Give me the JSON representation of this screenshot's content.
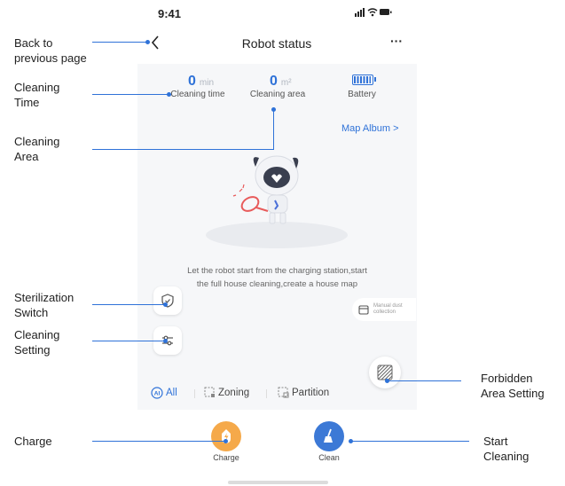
{
  "status_bar": {
    "time": "9:41",
    "icons": "signal wifi battery"
  },
  "nav": {
    "title": "Robot status",
    "more": "···"
  },
  "stats": {
    "time_value": "0",
    "time_unit": "min",
    "time_label": "Cleaning time",
    "area_value": "0",
    "area_unit": "m²",
    "area_label": "Cleaning area",
    "battery_label": "Battery",
    "battery_level": 1.0
  },
  "map_album": "Map Album >",
  "hint_line1": "Let the robot start from the charging station,start",
  "hint_line2": "the full house cleaning,create a house map",
  "dust_label": "Manual dust collection",
  "modes": {
    "all": "All",
    "zoning": "Zoning",
    "partition": "Partition",
    "all_badge": "AI"
  },
  "actions": {
    "charge": "Charge",
    "clean": "Clean"
  },
  "colors": {
    "accent": "#2f72d8",
    "charge": "#f5a94a",
    "clean": "#3c79d6"
  },
  "callouts": {
    "back_line1": "Back to",
    "back_line2": "previous page",
    "time_line1": "Cleaning",
    "time_line2": "Time",
    "area_line1": "Cleaning",
    "area_line2": "Area",
    "steril_line1": "Sterilization",
    "steril_line2": "Switch",
    "setting_line1": "Cleaning",
    "setting_line2": "Setting",
    "forbid_line1": "Forbidden",
    "forbid_line2": "Area Setting",
    "charge": "Charge",
    "start_line1": "Start",
    "start_line2": "Cleaning"
  }
}
